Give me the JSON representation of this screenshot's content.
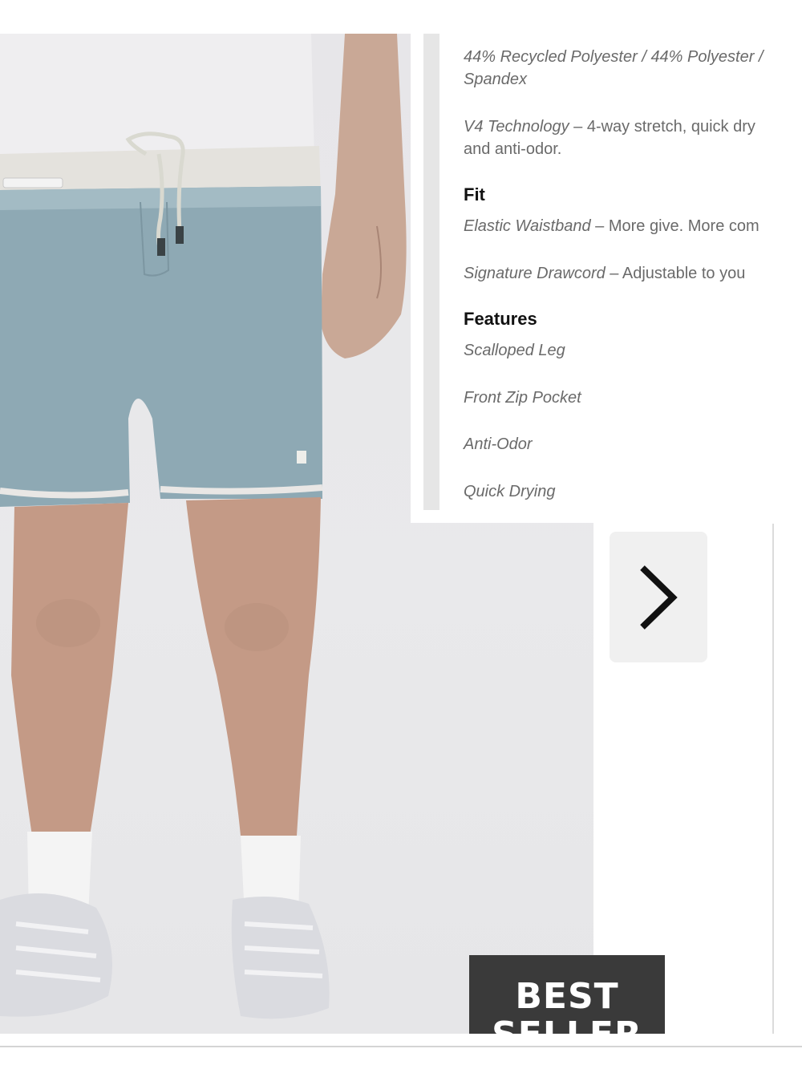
{
  "details": {
    "material_line1": "44% Recycled Polyester / 44% Polyester /",
    "material_line2": "Spandex",
    "tech_name": "V4 Technology",
    "tech_desc_line1": " – 4-way stretch, quick dry",
    "tech_desc_line2": "and anti-odor.",
    "fit_heading": "Fit",
    "fit_items": [
      {
        "name": "Elastic Waistband",
        "desc": " – More give. More com"
      },
      {
        "name": "Signature Drawcord",
        "desc": " – Adjustable to you"
      }
    ],
    "features_heading": "Features",
    "features_items": [
      "Scalloped Leg",
      "Front Zip Pocket",
      "Anti-Odor",
      "Quick Drying"
    ]
  },
  "badge": {
    "line1": "BEST",
    "line2": "SELLER"
  },
  "icons": {
    "next": "chevron-right-icon",
    "photo": "product-photo"
  }
}
